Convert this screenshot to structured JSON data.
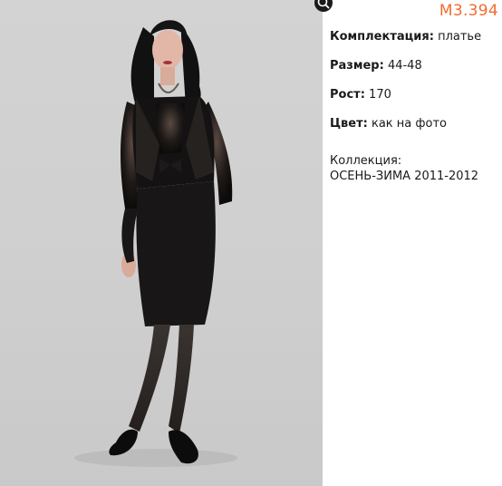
{
  "sku": "М3.394",
  "specs": [
    {
      "label": "Комплектация:",
      "value": "платье"
    },
    {
      "label": "Размер:",
      "value": "44-48"
    },
    {
      "label": "Рост:",
      "value": "170"
    },
    {
      "label": "Цвет:",
      "value": "как на фото"
    }
  ],
  "collection": {
    "label": "Коллекция:",
    "value": "ОСЕНЬ-ЗИМА 2011-2012"
  },
  "colors": {
    "sku": "#f26c2e",
    "photo_background": "#d0d0d0"
  },
  "icons": {
    "zoom": "zoom-icon"
  }
}
